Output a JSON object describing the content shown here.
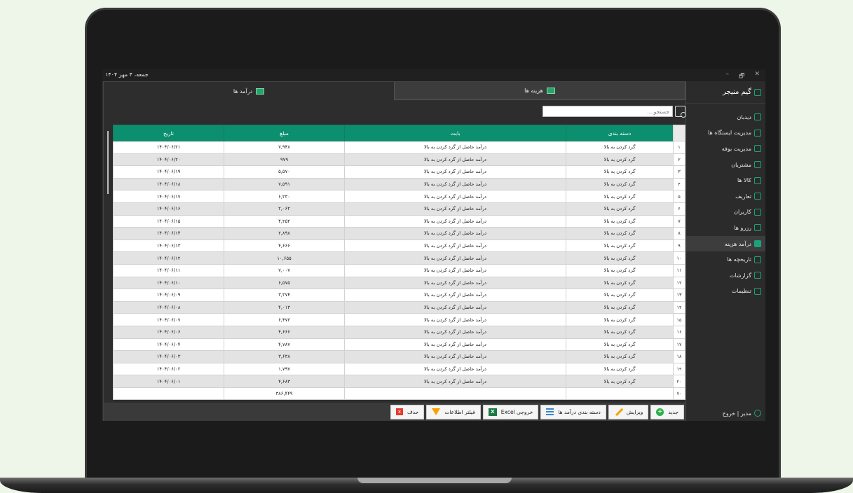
{
  "titlebar": {
    "date": "جمعه، ۴ مهر ۱۴۰۴",
    "controls": [
      "–",
      "🗗",
      "✕"
    ]
  },
  "brand": {
    "title": "گیم منیجر"
  },
  "sidebar": {
    "items": [
      {
        "label": "دیدبان",
        "active": false
      },
      {
        "label": "مدیریت ایستگاه ها",
        "active": false
      },
      {
        "label": "مدیریت بوفه",
        "active": false
      },
      {
        "label": "مشتریان",
        "active": false
      },
      {
        "label": "کالا ها",
        "active": false
      },
      {
        "label": "تعاریف",
        "active": false
      },
      {
        "label": "کاربران",
        "active": false
      },
      {
        "label": "رزرو ها",
        "active": false
      },
      {
        "label": "درآمد هزینه",
        "active": true
      },
      {
        "label": "تاریخچه ها",
        "active": false
      },
      {
        "label": "گزارشات",
        "active": false
      },
      {
        "label": "تنظیمات",
        "active": false
      }
    ],
    "logout": "مدیر | خروج"
  },
  "tabs": [
    {
      "label": "هزینه ها",
      "active": false
    },
    {
      "label": "درآمد ها",
      "active": true
    }
  ],
  "search": {
    "placeholder": "جستجو ..."
  },
  "table": {
    "headers": [
      "دسته بندی",
      "بابت",
      "مبلغ",
      "تاریخ"
    ],
    "category": "گرد کردن به بالا",
    "description": "درآمد حاصل از گرد کردن به بالا",
    "rows": [
      {
        "num": "۱",
        "amount": "۷,۹۴۸",
        "date": "۱۴۰۴/۰۶/۲۱"
      },
      {
        "num": "۲",
        "amount": "۹۷۹",
        "date": "۱۴۰۴/۰۶/۲۰"
      },
      {
        "num": "۳",
        "amount": "۵,۵۷۰",
        "date": "۱۴۰۴/۰۶/۱۹"
      },
      {
        "num": "۴",
        "amount": "۷,۵۹۱",
        "date": "۱۴۰۴/۰۶/۱۸"
      },
      {
        "num": "۵",
        "amount": "۶,۲۳۰",
        "date": "۱۴۰۴/۰۶/۱۷"
      },
      {
        "num": "۶",
        "amount": "۲,۰۶۲",
        "date": "۱۴۰۴/۰۶/۱۶"
      },
      {
        "num": "۷",
        "amount": "۴,۲۵۲",
        "date": "۱۴۰۴/۰۶/۱۵"
      },
      {
        "num": "۸",
        "amount": "۲,۸۹۸",
        "date": "۱۴۰۴/۰۶/۱۴"
      },
      {
        "num": "۹",
        "amount": "۴,۶۶۶",
        "date": "۱۴۰۴/۰۶/۱۳"
      },
      {
        "num": "۱۰",
        "amount": "۱۰,۶۵۵",
        "date": "۱۴۰۴/۰۶/۱۲"
      },
      {
        "num": "۱۱",
        "amount": "۷,۰۰۷",
        "date": "۱۴۰۴/۰۶/۱۱"
      },
      {
        "num": "۱۲",
        "amount": "۶,۵۷۵",
        "date": "۱۴۰۴/۰۶/۱۰"
      },
      {
        "num": "۱۳",
        "amount": "۳,۲۷۴",
        "date": "۱۴۰۴/۰۶/۰۹"
      },
      {
        "num": "۱۴",
        "amount": "۴,۰۱۳",
        "date": "۱۴۰۴/۰۶/۰۸"
      },
      {
        "num": "۱۵",
        "amount": "۶,۴۷۳",
        "date": "۱۴۰۴/۰۶/۰۷"
      },
      {
        "num": "۱۶",
        "amount": "۴,۶۶۶",
        "date": "۱۴۰۴/۰۶/۰۶"
      },
      {
        "num": "۱۷",
        "amount": "۴,۷۸۷",
        "date": "۱۴۰۴/۰۶/۰۴"
      },
      {
        "num": "۱۸",
        "amount": "۳,۶۳۸",
        "date": "۱۴۰۴/۰۶/۰۳"
      },
      {
        "num": "۱۹",
        "amount": "۱,۷۹۷",
        "date": "۱۴۰۴/۰۶/۰۲"
      },
      {
        "num": "۲۰",
        "amount": "۴,۶۸۳",
        "date": "۱۴۰۴/۰۶/۰۱"
      }
    ],
    "total": {
      "count": "۷۰",
      "amount": "۳۸۶,۴۴۹"
    }
  },
  "toolbar": {
    "new": "جدید",
    "edit": "ویرایش",
    "categories": "دسته بندی درآمد ها",
    "excel": "خروجی Excel",
    "filter": "فیلتر اطلاعات",
    "delete": "حذف"
  },
  "colors": {
    "accent": "#0b8f6f",
    "icon_green": "#1aa37a",
    "background": "#eef6ea"
  }
}
